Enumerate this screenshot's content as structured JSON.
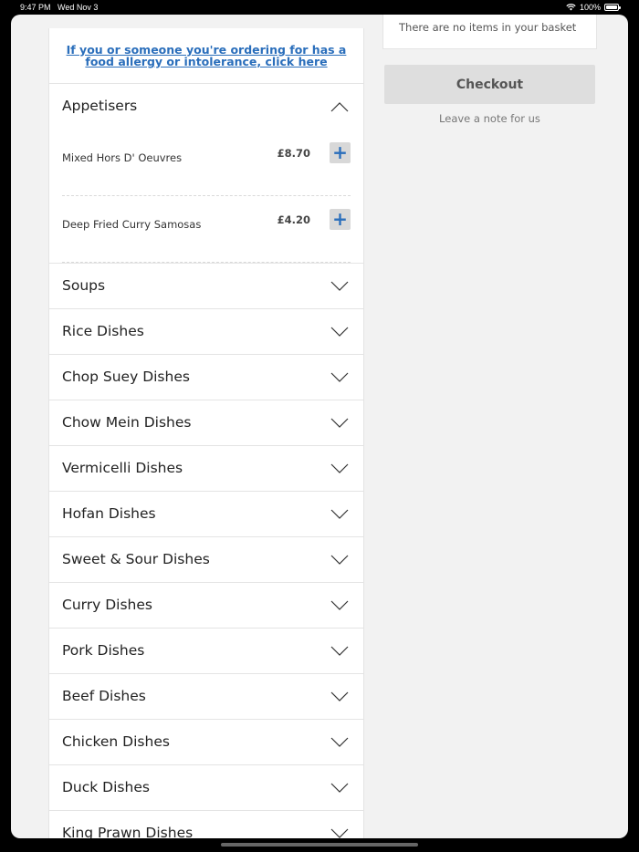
{
  "status_bar": {
    "time": "9:47 PM",
    "date": "Wed Nov 3",
    "battery": "100%",
    "battery_level": 1.0,
    "icons": [
      "wifi-icon",
      "battery-icon"
    ]
  },
  "menu": {
    "allergy_notice": "If you or someone you're ordering for has a food allergy or intolerance, click here",
    "expanded_category": {
      "name": "Appetisers",
      "items": [
        {
          "name": "Mixed Hors D' Oeuvres",
          "price": "£8.70",
          "add": "+"
        },
        {
          "name": "Deep Fried Curry Samosas",
          "price": "£4.20",
          "add": "+"
        }
      ]
    },
    "categories": [
      "Soups",
      "Rice Dishes",
      "Chop Suey Dishes",
      "Chow Mein Dishes",
      "Vermicelli Dishes",
      "Hofan Dishes",
      "Sweet & Sour Dishes",
      "Curry Dishes",
      "Pork Dishes",
      "Beef Dishes",
      "Chicken Dishes",
      "Duck Dishes",
      "King Prawn Dishes"
    ]
  },
  "basket": {
    "empty_text": "There are no items in your basket",
    "checkout_label": "Checkout",
    "note_label": "Leave a note for us"
  },
  "colors": {
    "link": "#2a6ebb",
    "background": "#f2f2f2",
    "button_disabled": "#dedede"
  }
}
